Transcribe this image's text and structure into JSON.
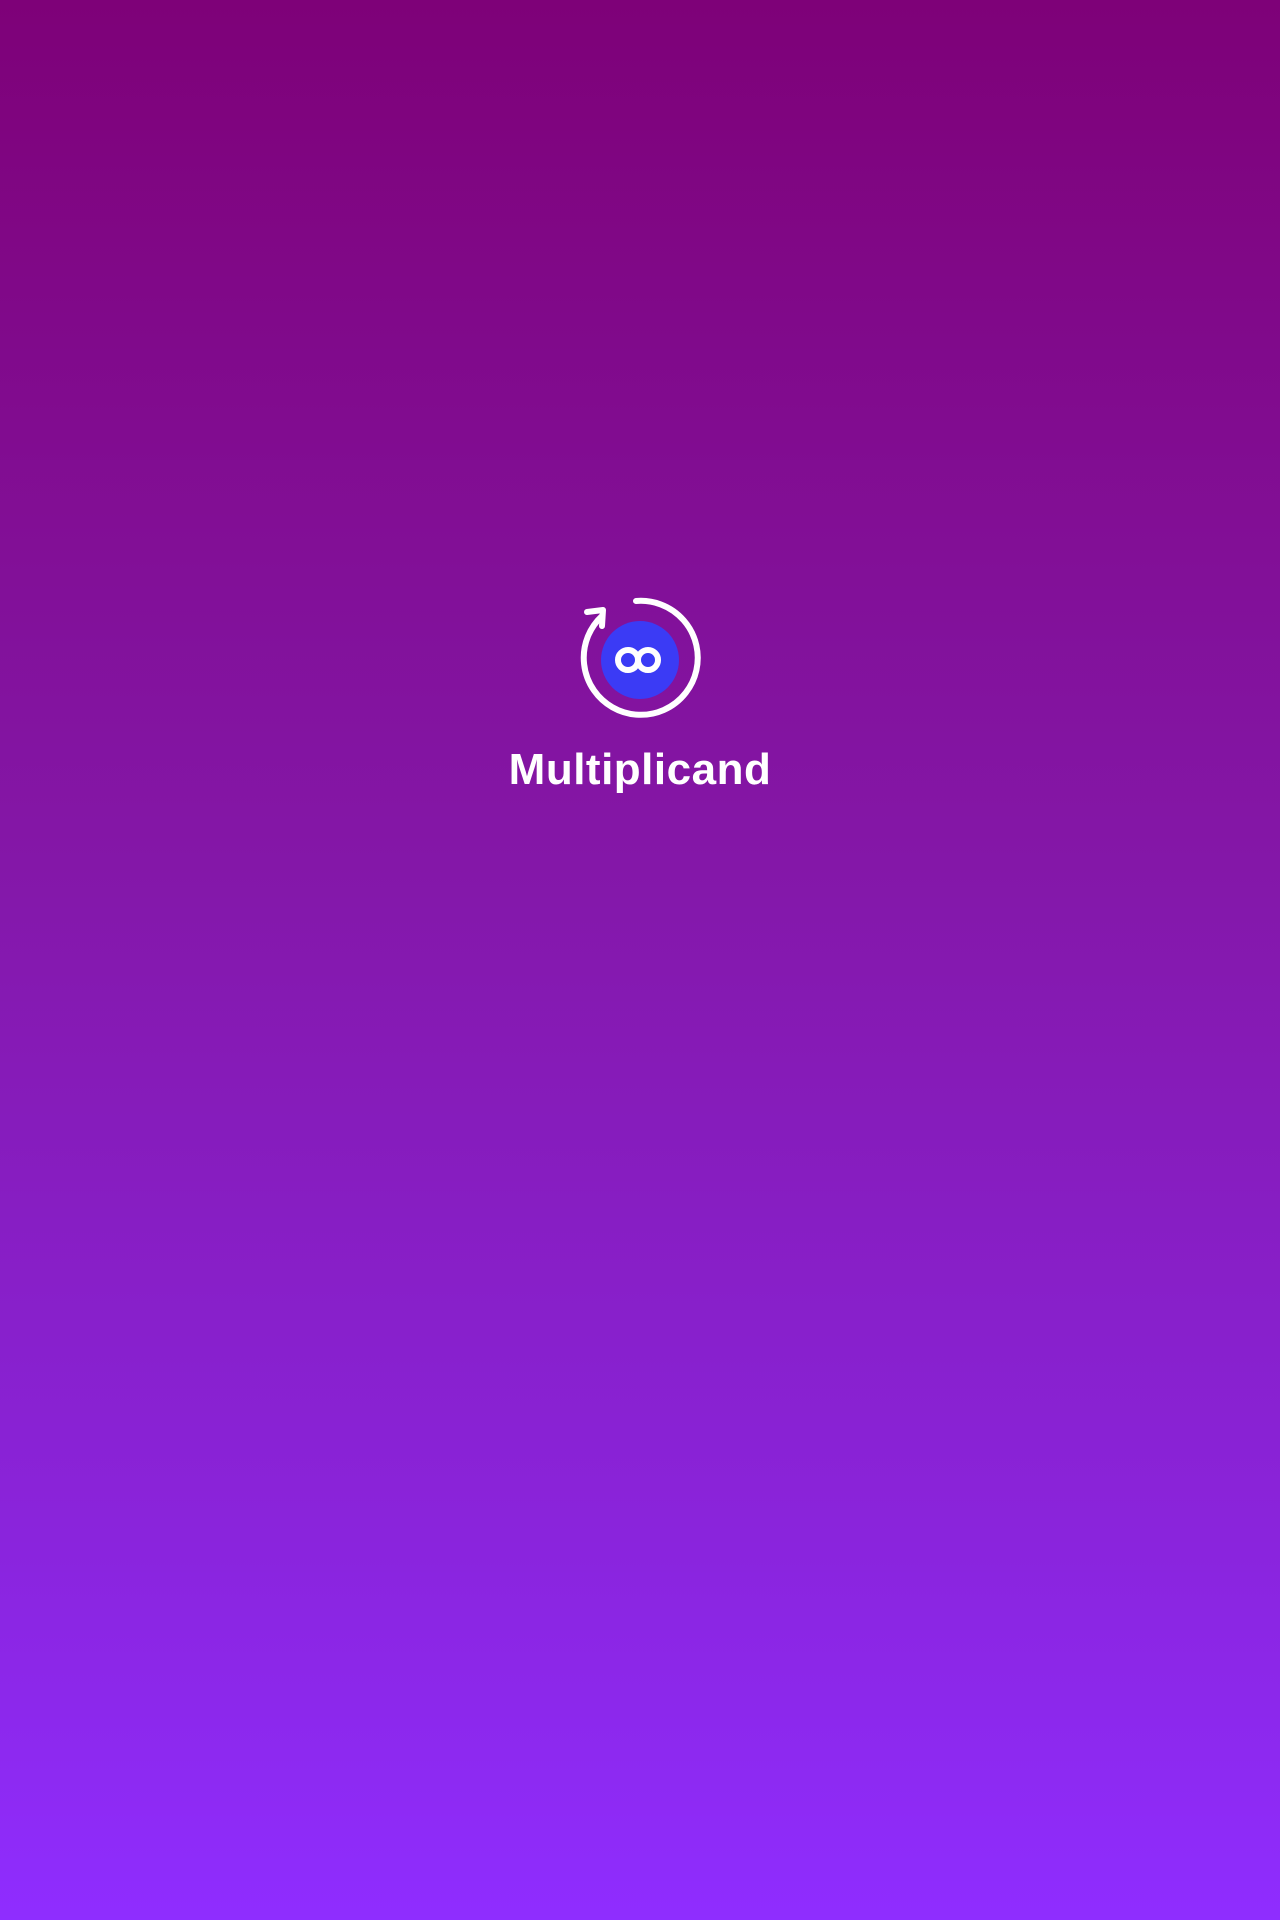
{
  "app": {
    "name": "Multiplicand"
  },
  "logo": {
    "icon": "infinity-refresh-icon",
    "ring_color": "#FFFFFF",
    "badge_color": "#3B3BF5",
    "glyph_color": "#FFFFFF"
  },
  "colors": {
    "background_top": "#7E0178",
    "background_bottom": "#8F2DFF"
  }
}
